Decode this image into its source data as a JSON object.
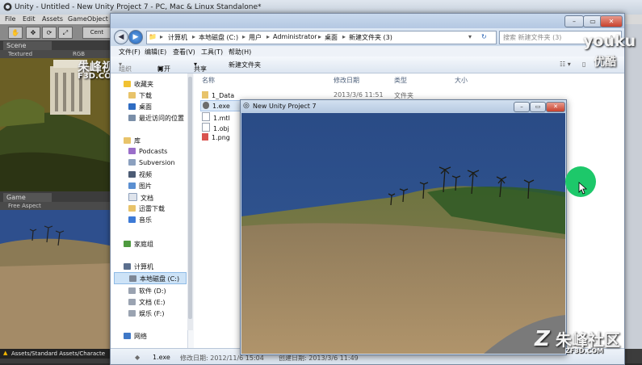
{
  "unity": {
    "title": "Unity - Untitled - New Unity Project 7 - PC, Mac & Linux Standalone*",
    "menu": [
      "File",
      "Edit",
      "Assets",
      "GameObject"
    ],
    "toolbar": {
      "center_label": "Cent"
    },
    "scene_tab": "Scene",
    "scene_mode": "Textured",
    "scene_rgb": "RGB",
    "game_tab": "Game",
    "game_aspect": "Free Aspect",
    "status_text": "Assets/Standard Assets/Characte"
  },
  "watermark_top": {
    "line1": "朱峰视",
    "line2": "F3D.CO"
  },
  "explorer": {
    "address": [
      "计算机",
      "本地磁盘 (C:)",
      "用户",
      "Administrator",
      "桌面",
      "新建文件夹 (3)"
    ],
    "search_placeholder": "搜索 新建文件夹 (3)",
    "menu": [
      "文件(F)",
      "编辑(E)",
      "查看(V)",
      "工具(T)",
      "帮助(H)"
    ],
    "commands": {
      "organize": "组织",
      "open": "打开",
      "share": "共享",
      "new_folder": "新建文件夹"
    },
    "nav": {
      "favorites": "收藏夹",
      "favorites_items": [
        "下载",
        "桌面",
        "最近访问的位置"
      ],
      "libraries": "库",
      "library_items": [
        "Podcasts",
        "Subversion",
        "视频",
        "图片",
        "文档",
        "迅雷下载",
        "音乐"
      ],
      "homegroup": "家庭组",
      "computer": "计算机",
      "drives": [
        "本地磁盘 (C:)",
        "软件 (D:)",
        "文档 (E:)",
        "娱乐 (F:)"
      ],
      "network": "网络"
    },
    "columns": [
      "名称",
      "修改日期",
      "类型",
      "大小"
    ],
    "files": [
      {
        "name": "1_Data",
        "date": "2013/3/6 11:51",
        "type": "文件夹"
      },
      {
        "name": "1.exe",
        "date": "",
        "type": ""
      },
      {
        "name": "1.mtl",
        "date": "",
        "type": ""
      },
      {
        "name": "1.obj",
        "date": "",
        "type": ""
      },
      {
        "name": "1.png",
        "date": "",
        "type": ""
      }
    ],
    "details": {
      "name": "1.exe",
      "modified": "修改日期: 2012/11/6 15:04",
      "created": "创建日期: 2013/3/6 11:49"
    }
  },
  "player": {
    "title": "New Unity Project 7"
  },
  "overlay": {
    "youku": "youku",
    "youku_cn": "优酷",
    "logo": "朱峰社区",
    "logo_url": "ZF3D.COM"
  },
  "colors": {
    "sky": "#2d4f8b",
    "sand": "#a48b68",
    "accent_green": "#1dc86a"
  }
}
